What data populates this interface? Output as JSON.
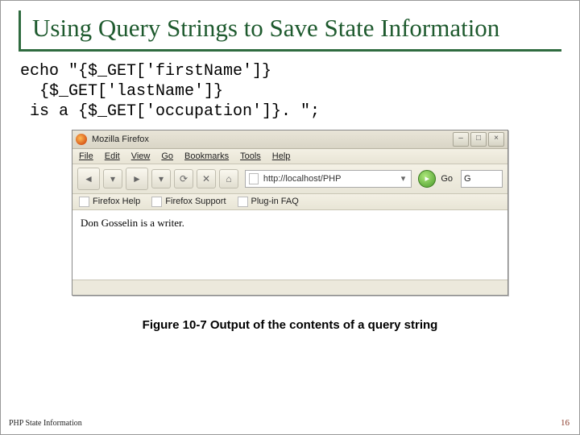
{
  "title": "Using Query Strings to Save State Information",
  "code": "echo \"{$_GET['firstName']}\n  {$_GET['lastName']}\n is a {$_GET['occupation']}. \";",
  "browser": {
    "title": "Mozilla Firefox",
    "menus": [
      "File",
      "Edit",
      "View",
      "Go",
      "Bookmarks",
      "Tools",
      "Help"
    ],
    "url": "http://localhost/PHP",
    "go_label": "Go",
    "search_hint": "G",
    "bookmarks": [
      "Firefox Help",
      "Firefox Support",
      "Plug-in FAQ"
    ],
    "page_text": "Don Gosselin is a writer."
  },
  "caption": "Figure 10-7 Output of the contents of a query string",
  "footer_left": "PHP State Information",
  "footer_right": "16"
}
